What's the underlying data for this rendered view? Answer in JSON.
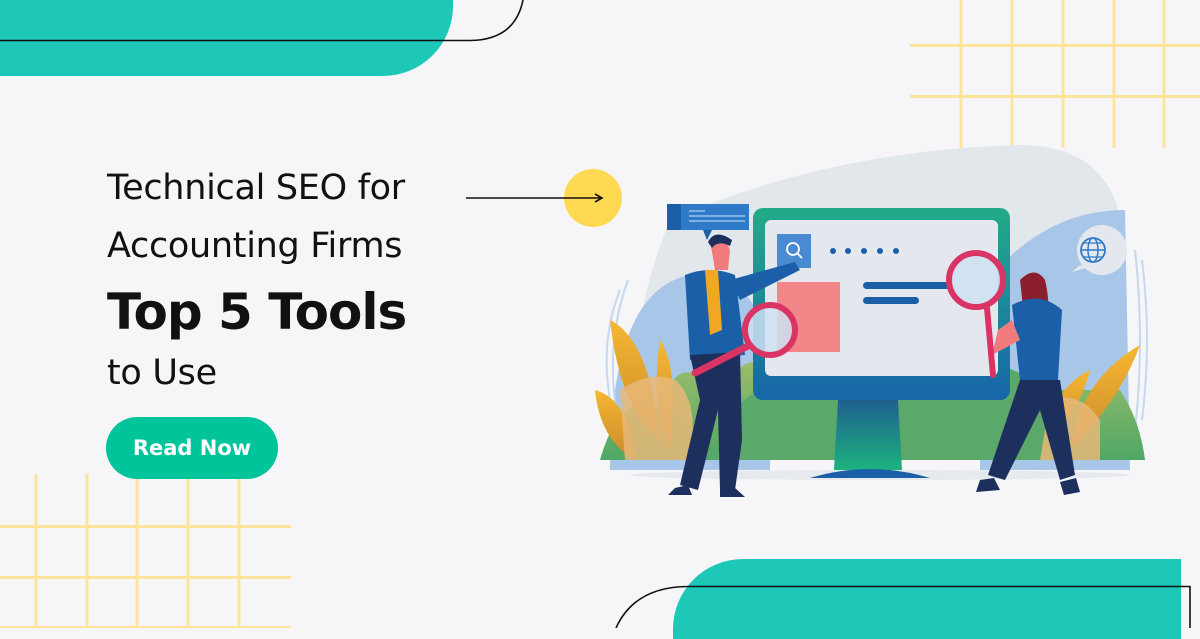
{
  "banner": {
    "title_line1": "Technical SEO for",
    "title_line2": "Accounting Firms",
    "title_highlight": "Top 5 Tools",
    "title_line4": "to Use",
    "cta_label": "Read Now"
  },
  "colors": {
    "background": "#f6f6f9",
    "teal_accent": "#1ec8b8",
    "cta_green": "#00c49a",
    "grid_yellow": "#fde49a",
    "arrow_circle_yellow": "#ffd952",
    "text_dark": "#111111"
  },
  "icons": {
    "arrow": "arrow-right-icon",
    "search": "search-icon",
    "globe": "globe-icon",
    "magnifier": "magnifying-glass-icon",
    "chat": "chat-bubble-icon"
  },
  "illustration": {
    "description": "Two people inspecting a website on a large monitor with magnifying glasses",
    "monitor_dots": 5
  }
}
